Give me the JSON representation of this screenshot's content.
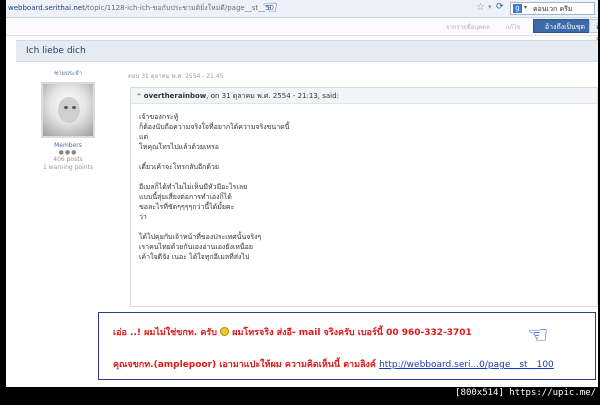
{
  "browser": {
    "url_domain": "webboard.serithai.net",
    "url_path": "/topic/1128-ich-ich-ขอกับประชามติยิ่งใหม่ดี/page__st__50",
    "search_text": "คอนเวก ครีม"
  },
  "toolbar": {
    "faded_left": "จากรายชื่อบุคคล",
    "faded_mid": "แก้ไข",
    "btn_reply": "อ้างถึงเป็นชุด",
    "btn_quote": "อ้างถึง"
  },
  "topic": {
    "title": "Ich liebe dich"
  },
  "author": {
    "name": "ชายประจำ",
    "group": "Members",
    "pips": "●●●",
    "posts": "406 posts",
    "warning": "1 warning points"
  },
  "post": {
    "date": "ตอบ 31 ตุลาคม พ.ศ. 2554 - 21:45"
  },
  "quote": {
    "author": "overtherainbow",
    "when": ", on 31 ตุลาคม พ.ศ. 2554 - 21:13, said:",
    "lines": [
      "เจ้าของกระทู้",
      "ก็ต้องนับถือความจริงใจที่อยากได้ความจริงขนาดนี้",
      "แต่",
      "โหคุณโทรไปแล้วด้วยเหรอ",
      "",
      "เดี๋ยวเค้าจะโทรกลับอีกด้วย",
      "",
      "อีเมลก็ได้ทำไมไม่เห็นมีหัวมีอะไรเลย",
      "แบบนี้สุ่มเสี่ยงต่อการทำเองก็ได้",
      "ขอละไรที่ชัดๆๆๆๆกว่านี้ได้มั้ยคะ",
      "ว่า",
      "",
      "ได้ไปคุยกับเจ้าหน้าที่ของประเทศนั้นจริงๆ",
      "เราคนไทยด้วยกันเองอ่านเองยังเหนื่อย",
      "เค้าใจดีจัง เนอะ ได้ใจทุกอีเมลที่ส่งไป"
    ]
  },
  "notice": {
    "line1_a": "เอ่อ ..! ผมไม่ใช่ขกท. ครับ",
    "line1_b": " ผมโทรจริง ส่งอี- mail จริงครับ เบอร์นี้ 00 960-332-3701",
    "line2_a": "คุณจขกท.(amplepoor) เอามาแปะให้ผม ความคิดเห็นนี้ ตามลิงค์ ",
    "line2_link": "http://webboard.seri...0/page__st__100"
  },
  "watermark": "[800x514] https://upic.me/",
  "colors": {
    "accent": "#3c6aa8",
    "notice_red": "#e01818",
    "link_blue": "#1a3bb5",
    "hand_blue": "#1a4fbf"
  },
  "icons": {
    "hand": "pointing-hand-icon",
    "smile": "smiley-icon",
    "star": "star-icon"
  }
}
